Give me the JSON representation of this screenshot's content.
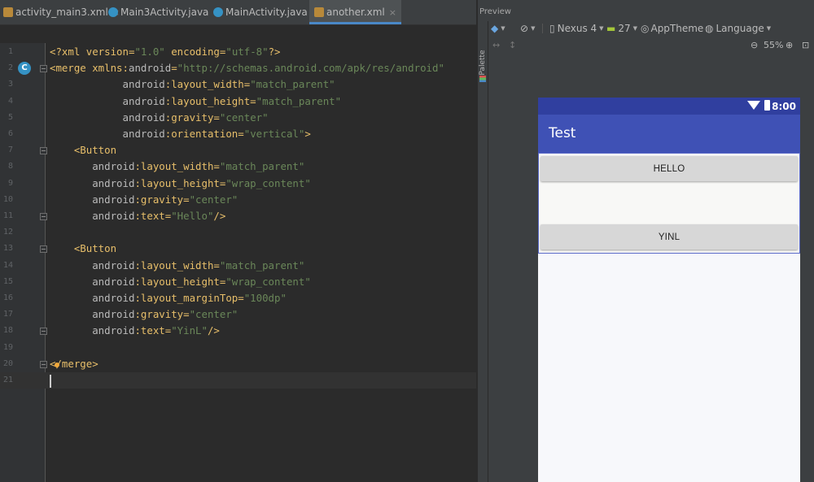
{
  "tabs": [
    {
      "label": "activity_main3.xml",
      "icon": "xml-file-icon",
      "active": false
    },
    {
      "label": "Main3Activity.java",
      "icon": "java-class-icon",
      "active": false
    },
    {
      "label": "MainActivity.java",
      "icon": "java-class-icon",
      "active": false
    },
    {
      "label": "another.xml",
      "icon": "xml-file-icon",
      "active": true
    }
  ],
  "editor": {
    "lines": [
      {
        "n": "1",
        "tokens": [
          [
            "t",
            "<?xml version="
          ],
          [
            "v",
            "\"1.0\""
          ],
          [
            "t",
            " encoding="
          ],
          [
            "v",
            "\"utf-8\""
          ],
          [
            "t",
            "?>"
          ]
        ]
      },
      {
        "n": "2",
        "tokens": [
          [
            "t",
            "<merge xmlns:"
          ],
          [
            "a",
            "android"
          ],
          [
            "t",
            "="
          ],
          [
            "v",
            "\"http://schemas.android.com/apk/res/android\""
          ]
        ]
      },
      {
        "n": "3",
        "tokens": [
          [
            "p",
            "            "
          ],
          [
            "a",
            "android"
          ],
          [
            "t",
            ":layout_width="
          ],
          [
            "v",
            "\"match_parent\""
          ]
        ]
      },
      {
        "n": "4",
        "tokens": [
          [
            "p",
            "            "
          ],
          [
            "a",
            "android"
          ],
          [
            "t",
            ":layout_height="
          ],
          [
            "v",
            "\"match_parent\""
          ]
        ]
      },
      {
        "n": "5",
        "tokens": [
          [
            "p",
            "            "
          ],
          [
            "a",
            "android"
          ],
          [
            "t",
            ":gravity="
          ],
          [
            "v",
            "\"center\""
          ]
        ]
      },
      {
        "n": "6",
        "tokens": [
          [
            "p",
            "            "
          ],
          [
            "a",
            "android"
          ],
          [
            "t",
            ":orientation="
          ],
          [
            "v",
            "\"vertical\""
          ],
          [
            "t",
            ">"
          ]
        ]
      },
      {
        "n": "7",
        "tokens": [
          [
            "p",
            "    "
          ],
          [
            "t",
            "<Button"
          ]
        ]
      },
      {
        "n": "8",
        "tokens": [
          [
            "p",
            "       "
          ],
          [
            "a",
            "android"
          ],
          [
            "t",
            ":layout_width="
          ],
          [
            "v",
            "\"match_parent\""
          ]
        ]
      },
      {
        "n": "9",
        "tokens": [
          [
            "p",
            "       "
          ],
          [
            "a",
            "android"
          ],
          [
            "t",
            ":layout_height="
          ],
          [
            "v",
            "\"wrap_content\""
          ]
        ]
      },
      {
        "n": "10",
        "tokens": [
          [
            "p",
            "       "
          ],
          [
            "a",
            "android"
          ],
          [
            "t",
            ":gravity="
          ],
          [
            "v",
            "\"center\""
          ]
        ]
      },
      {
        "n": "11",
        "tokens": [
          [
            "p",
            "       "
          ],
          [
            "a",
            "android"
          ],
          [
            "t",
            ":text="
          ],
          [
            "v",
            "\"Hello\""
          ],
          [
            "t",
            "/>"
          ]
        ]
      },
      {
        "n": "12",
        "tokens": []
      },
      {
        "n": "13",
        "tokens": [
          [
            "p",
            "    "
          ],
          [
            "t",
            "<Button"
          ]
        ]
      },
      {
        "n": "14",
        "tokens": [
          [
            "p",
            "       "
          ],
          [
            "a",
            "android"
          ],
          [
            "t",
            ":layout_width="
          ],
          [
            "v",
            "\"match_parent\""
          ]
        ]
      },
      {
        "n": "15",
        "tokens": [
          [
            "p",
            "       "
          ],
          [
            "a",
            "android"
          ],
          [
            "t",
            ":layout_height="
          ],
          [
            "v",
            "\"wrap_content\""
          ]
        ]
      },
      {
        "n": "16",
        "tokens": [
          [
            "p",
            "       "
          ],
          [
            "a",
            "android"
          ],
          [
            "t",
            ":layout_marginTop="
          ],
          [
            "v",
            "\"100dp\""
          ]
        ]
      },
      {
        "n": "17",
        "tokens": [
          [
            "p",
            "       "
          ],
          [
            "a",
            "android"
          ],
          [
            "t",
            ":gravity="
          ],
          [
            "v",
            "\"center\""
          ]
        ]
      },
      {
        "n": "18",
        "tokens": [
          [
            "p",
            "       "
          ],
          [
            "a",
            "android"
          ],
          [
            "t",
            ":text="
          ],
          [
            "v",
            "\"YinL\""
          ],
          [
            "t",
            "/>"
          ]
        ]
      },
      {
        "n": "19",
        "tokens": []
      },
      {
        "n": "20",
        "tokens": [
          [
            "t",
            "</merge>"
          ]
        ]
      },
      {
        "n": "21",
        "tokens": []
      }
    ],
    "fold_lines": [
      "2",
      "7",
      "11",
      "13",
      "18",
      "20"
    ],
    "class_marker_line": "2",
    "class_marker_letter": "C",
    "caret_line": "21"
  },
  "preview": {
    "title": "Preview",
    "palette_label": "Palette",
    "toolbar": {
      "device": "Nexus 4",
      "api": "27",
      "theme": "AppTheme",
      "language": "Language",
      "zoom": "55%"
    },
    "phone": {
      "time": "8:00",
      "app_title": "Test",
      "buttons": [
        "HELLO",
        "YINL"
      ]
    }
  },
  "colors": {
    "status_bar": "#303f9f",
    "app_bar": "#3f51b5",
    "tag": "#e8bf6a",
    "attr_value": "#6a8759"
  }
}
